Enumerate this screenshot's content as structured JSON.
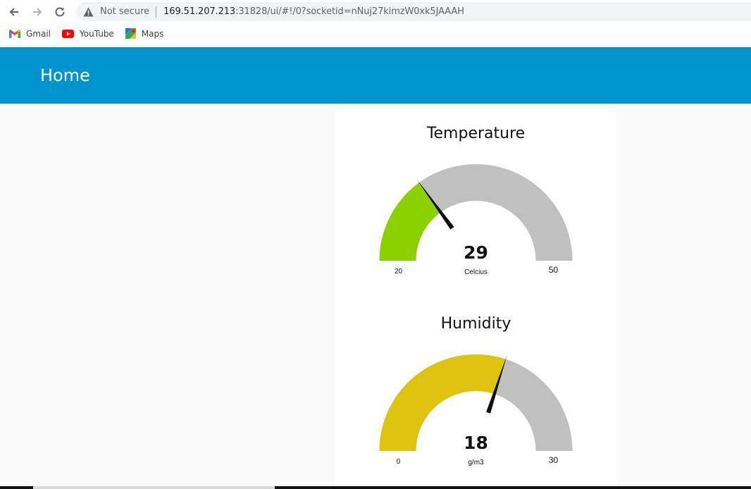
{
  "browser": {
    "security_label": "Not secure",
    "url_host": "169.51.207.213",
    "url_rest": ":31828/ui/#!/0?socketid=nNuj27kimzW0xk5JAAAH",
    "bookmarks": [
      {
        "label": "Gmail",
        "icon": "gmail-icon"
      },
      {
        "label": "YouTube",
        "icon": "youtube-icon"
      },
      {
        "label": "Maps",
        "icon": "maps-icon"
      }
    ]
  },
  "header": {
    "title": "Home",
    "color": "#0094ce"
  },
  "gauges": [
    {
      "title": "Temperature",
      "value": 29,
      "min": 20,
      "max": 50,
      "units": "Celcius",
      "color": "#8bd100",
      "track_color": "#c0c0c0"
    },
    {
      "title": "Humidity",
      "value": 18,
      "min": 0,
      "max": 30,
      "units": "g/m3",
      "color": "#dfc40f",
      "track_color": "#c0c0c0"
    }
  ]
}
